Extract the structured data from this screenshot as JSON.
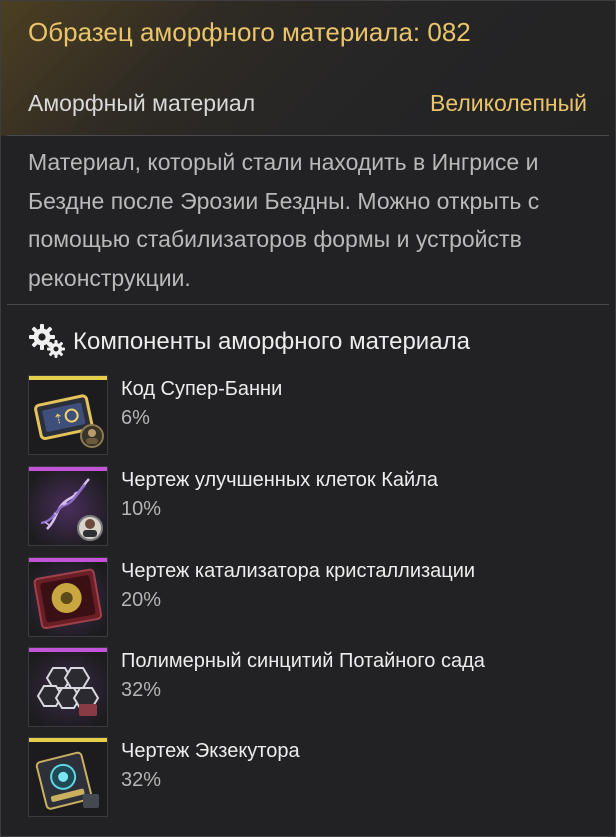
{
  "item": {
    "title": "Образец аморфного материала: 082",
    "type": "Аморфный материал",
    "rarity": "Великолепный",
    "description": "Материал, который стали находить в Ингрисе и Бездне после Эрозии Бездны. Можно открыть с помощью стабилизаторов формы и устройств реконструкции."
  },
  "components": {
    "title": "Компоненты аморфного материала",
    "items": [
      {
        "name": "Код Супер-Банни",
        "chance": "6%",
        "rarity_color": "#e6cf4d",
        "icon": "gold-card-icon"
      },
      {
        "name": "Чертеж улучшенных клеток Кайла",
        "chance": "10%",
        "rarity_color": "#c154d8",
        "icon": "dna-helix-icon"
      },
      {
        "name": "Чертеж катализатора кристаллизации",
        "chance": "20%",
        "rarity_color": "#c154d8",
        "icon": "catalyst-case-icon"
      },
      {
        "name": "Полимерный синцитий Потайного сада",
        "chance": "32%",
        "rarity_color": "#c154d8",
        "icon": "hex-tray-icon"
      },
      {
        "name": "Чертеж Экзекутора",
        "chance": "32%",
        "rarity_color": "#e6cf4d",
        "icon": "executor-device-icon"
      }
    ]
  },
  "colors": {
    "accent_gold": "#e9c46a",
    "background": "#222224"
  }
}
